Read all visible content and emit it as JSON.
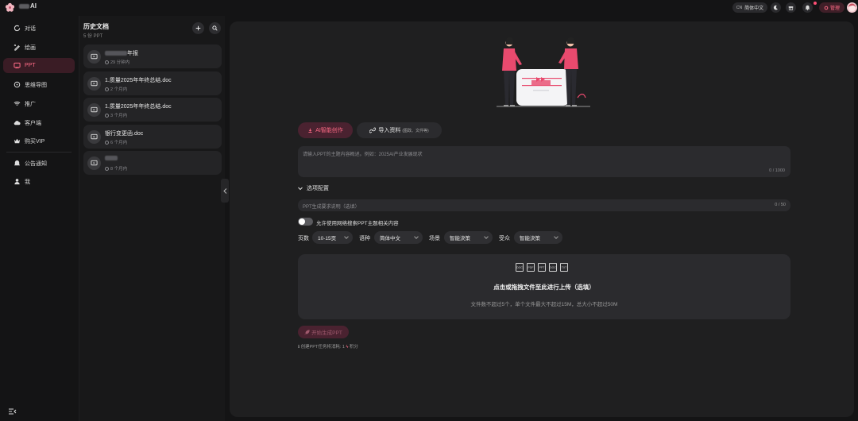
{
  "brand": {
    "name": "AI"
  },
  "topbar": {
    "lang_code": "CN",
    "lang_label": "简体中文",
    "admin_label": "管理"
  },
  "colors": {
    "accent": "#ff6b86",
    "accent_bg": "#3a1c25",
    "panel": "#1f1f20"
  },
  "sidebar": {
    "items": [
      {
        "label": "对话",
        "icon": "chat-icon"
      },
      {
        "label": "绘画",
        "icon": "paint-icon"
      },
      {
        "label": "PPT",
        "icon": "ppt-icon",
        "active": true
      },
      {
        "label": "思维导图",
        "icon": "mindmap-icon"
      },
      {
        "label": "推广",
        "icon": "promote-icon"
      },
      {
        "label": "客户端",
        "icon": "cloud-icon"
      },
      {
        "label": "购买VIP",
        "icon": "crown-icon"
      }
    ],
    "bottom_items": [
      {
        "label": "公告通知",
        "icon": "bell-icon"
      },
      {
        "label": "我",
        "icon": "user-icon"
      }
    ]
  },
  "history": {
    "title": "历史文档",
    "count": "5 份 PPT",
    "docs": [
      {
        "name": "年报",
        "time": "29 分钟内"
      },
      {
        "name": "1.质量2025年年终总结.doc",
        "time": "2 个月内"
      },
      {
        "name": "1.质量2025年年终总结.doc",
        "time": "3 个月内"
      },
      {
        "name": "银行变更函.doc",
        "time": "6 个月内"
      },
      {
        "name": "",
        "time": "8 个月内"
      }
    ]
  },
  "main": {
    "mode_ai": "AI智能创作",
    "mode_import": "导入资料",
    "mode_import_sub": "(图政、文件等)",
    "topic_placeholder": "请输入PPT的主题内容概述。例如：2025AI产业发展现状",
    "topic_count": "0 / 1000",
    "options_title": "选项配置",
    "req_placeholder": "PPT生成要求说明（选填）",
    "req_count": "0 / 50",
    "web_search_label": "允许使用网络搜索PPT主题相关内容",
    "pages_label": "页数",
    "pages_value": "10-15页",
    "lang_label": "语种",
    "lang_value": "简体中文",
    "scene_label": "场景",
    "scene_value": "智能決策",
    "audience_label": "受众",
    "audience_value": "智能決策",
    "upload_title": "点击或拖拽文件至此进行上传（选填）",
    "upload_sub": "文件数不超过5个，单个文件最大不超过15M，总大小不超过50M",
    "upload_types": [
      "DOC",
      "PDF",
      "PPT",
      "DOC",
      "TXT"
    ],
    "generate_label": "开始生成PPT",
    "cost_text": "创建PPT任务将消耗: 1",
    "cost_unit": "积分"
  }
}
